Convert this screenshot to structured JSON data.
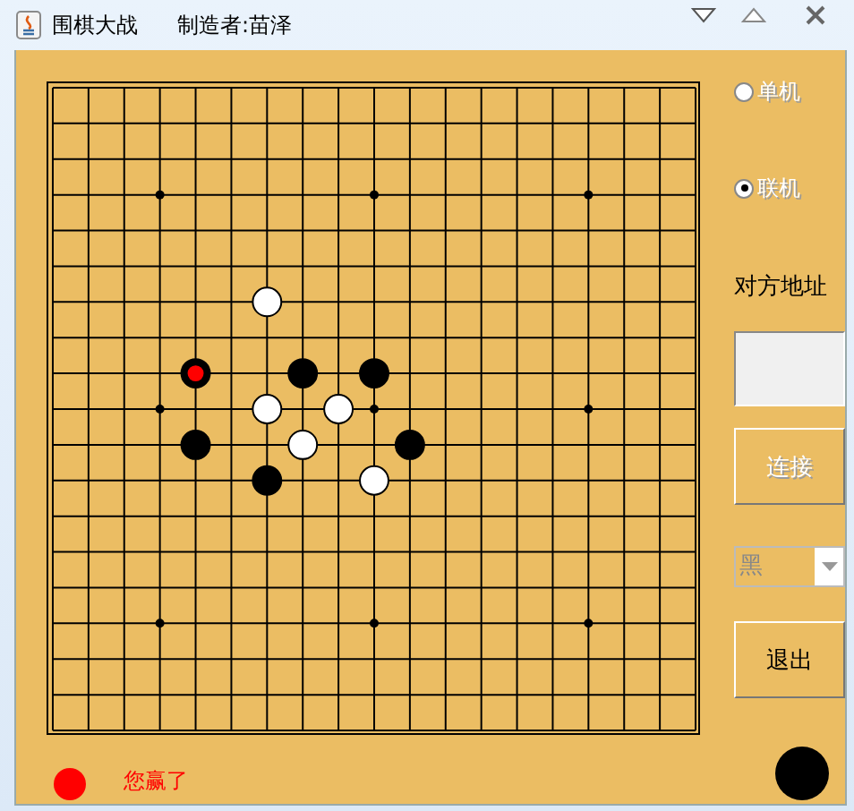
{
  "window": {
    "title": "围棋大战",
    "author": "制造者:苗泽"
  },
  "board": {
    "rows": [
      {
        "points": [
          {
            "kind": "empty"
          },
          {
            "kind": "empty"
          },
          {
            "kind": "empty"
          },
          {
            "kind": "empty"
          },
          {
            "kind": "empty"
          },
          {
            "kind": "empty"
          },
          {
            "kind": "empty"
          },
          {
            "kind": "empty"
          },
          {
            "kind": "empty"
          },
          {
            "kind": "empty"
          },
          {
            "kind": "empty"
          },
          {
            "kind": "empty"
          },
          {
            "kind": "empty"
          },
          {
            "kind": "empty"
          },
          {
            "kind": "empty"
          },
          {
            "kind": "empty"
          },
          {
            "kind": "empty"
          },
          {
            "kind": "empty"
          },
          {
            "kind": "empty"
          }
        ]
      },
      {
        "points": [
          {
            "kind": "empty"
          },
          {
            "kind": "empty"
          },
          {
            "kind": "empty"
          },
          {
            "kind": "empty"
          },
          {
            "kind": "empty"
          },
          {
            "kind": "empty"
          },
          {
            "kind": "empty"
          },
          {
            "kind": "empty"
          },
          {
            "kind": "empty"
          },
          {
            "kind": "empty"
          },
          {
            "kind": "empty"
          },
          {
            "kind": "empty"
          },
          {
            "kind": "empty"
          },
          {
            "kind": "empty"
          },
          {
            "kind": "empty"
          },
          {
            "kind": "empty"
          },
          {
            "kind": "empty"
          },
          {
            "kind": "empty"
          },
          {
            "kind": "empty"
          }
        ]
      },
      {
        "points": [
          {
            "kind": "empty"
          },
          {
            "kind": "empty"
          },
          {
            "kind": "empty"
          },
          {
            "kind": "empty"
          },
          {
            "kind": "empty"
          },
          {
            "kind": "empty"
          },
          {
            "kind": "empty"
          },
          {
            "kind": "empty"
          },
          {
            "kind": "empty"
          },
          {
            "kind": "empty"
          },
          {
            "kind": "empty"
          },
          {
            "kind": "empty"
          },
          {
            "kind": "empty"
          },
          {
            "kind": "empty"
          },
          {
            "kind": "empty"
          },
          {
            "kind": "empty"
          },
          {
            "kind": "empty"
          },
          {
            "kind": "empty"
          },
          {
            "kind": "empty"
          }
        ]
      },
      {
        "points": [
          {
            "kind": "empty"
          },
          {
            "kind": "empty"
          },
          {
            "kind": "empty"
          },
          {
            "kind": "empty"
          },
          {
            "kind": "empty"
          },
          {
            "kind": "empty"
          },
          {
            "kind": "empty"
          },
          {
            "kind": "empty"
          },
          {
            "kind": "empty"
          },
          {
            "kind": "empty"
          },
          {
            "kind": "empty"
          },
          {
            "kind": "empty"
          },
          {
            "kind": "empty"
          },
          {
            "kind": "empty"
          },
          {
            "kind": "empty"
          },
          {
            "kind": "empty"
          },
          {
            "kind": "empty"
          },
          {
            "kind": "empty"
          },
          {
            "kind": "empty"
          }
        ]
      },
      {
        "points": [
          {
            "kind": "empty"
          },
          {
            "kind": "empty"
          },
          {
            "kind": "empty"
          },
          {
            "kind": "empty"
          },
          {
            "kind": "empty"
          },
          {
            "kind": "empty"
          },
          {
            "kind": "empty"
          },
          {
            "kind": "empty"
          },
          {
            "kind": "empty"
          },
          {
            "kind": "empty"
          },
          {
            "kind": "empty"
          },
          {
            "kind": "empty"
          },
          {
            "kind": "empty"
          },
          {
            "kind": "empty"
          },
          {
            "kind": "empty"
          },
          {
            "kind": "empty"
          },
          {
            "kind": "empty"
          },
          {
            "kind": "empty"
          },
          {
            "kind": "empty"
          }
        ]
      },
      {
        "points": [
          {
            "kind": "empty"
          },
          {
            "kind": "empty"
          },
          {
            "kind": "empty"
          },
          {
            "kind": "empty"
          },
          {
            "kind": "empty"
          },
          {
            "kind": "empty"
          },
          {
            "kind": "empty"
          },
          {
            "kind": "empty"
          },
          {
            "kind": "empty"
          },
          {
            "kind": "empty"
          },
          {
            "kind": "empty"
          },
          {
            "kind": "empty"
          },
          {
            "kind": "empty"
          },
          {
            "kind": "empty"
          },
          {
            "kind": "empty"
          },
          {
            "kind": "empty"
          },
          {
            "kind": "empty"
          },
          {
            "kind": "empty"
          },
          {
            "kind": "empty"
          }
        ]
      },
      {
        "points": [
          {
            "kind": "empty"
          },
          {
            "kind": "empty"
          },
          {
            "kind": "empty"
          },
          {
            "kind": "empty"
          },
          {
            "kind": "empty"
          },
          {
            "kind": "empty"
          },
          {
            "kind": "white"
          },
          {
            "kind": "empty"
          },
          {
            "kind": "empty"
          },
          {
            "kind": "empty"
          },
          {
            "kind": "empty"
          },
          {
            "kind": "empty"
          },
          {
            "kind": "empty"
          },
          {
            "kind": "empty"
          },
          {
            "kind": "empty"
          },
          {
            "kind": "empty"
          },
          {
            "kind": "empty"
          },
          {
            "kind": "empty"
          },
          {
            "kind": "empty"
          }
        ]
      },
      {
        "points": [
          {
            "kind": "empty"
          },
          {
            "kind": "empty"
          },
          {
            "kind": "empty"
          },
          {
            "kind": "empty"
          },
          {
            "kind": "empty"
          },
          {
            "kind": "empty"
          },
          {
            "kind": "empty"
          },
          {
            "kind": "empty"
          },
          {
            "kind": "empty"
          },
          {
            "kind": "empty"
          },
          {
            "kind": "empty"
          },
          {
            "kind": "empty"
          },
          {
            "kind": "empty"
          },
          {
            "kind": "empty"
          },
          {
            "kind": "empty"
          },
          {
            "kind": "empty"
          },
          {
            "kind": "empty"
          },
          {
            "kind": "empty"
          },
          {
            "kind": "empty"
          }
        ]
      },
      {
        "points": [
          {
            "kind": "empty"
          },
          {
            "kind": "empty"
          },
          {
            "kind": "empty"
          },
          {
            "kind": "empty"
          },
          {
            "kind": "last"
          },
          {
            "kind": "empty"
          },
          {
            "kind": "empty"
          },
          {
            "kind": "black"
          },
          {
            "kind": "empty"
          },
          {
            "kind": "black"
          },
          {
            "kind": "empty"
          },
          {
            "kind": "empty"
          },
          {
            "kind": "empty"
          },
          {
            "kind": "empty"
          },
          {
            "kind": "empty"
          },
          {
            "kind": "empty"
          },
          {
            "kind": "empty"
          },
          {
            "kind": "empty"
          },
          {
            "kind": "empty"
          }
        ]
      },
      {
        "points": [
          {
            "kind": "empty"
          },
          {
            "kind": "empty"
          },
          {
            "kind": "empty"
          },
          {
            "kind": "empty"
          },
          {
            "kind": "empty"
          },
          {
            "kind": "empty"
          },
          {
            "kind": "white"
          },
          {
            "kind": "empty"
          },
          {
            "kind": "white"
          },
          {
            "kind": "empty"
          },
          {
            "kind": "empty"
          },
          {
            "kind": "empty"
          },
          {
            "kind": "empty"
          },
          {
            "kind": "empty"
          },
          {
            "kind": "empty"
          },
          {
            "kind": "empty"
          },
          {
            "kind": "empty"
          },
          {
            "kind": "empty"
          },
          {
            "kind": "empty"
          }
        ]
      },
      {
        "points": [
          {
            "kind": "empty"
          },
          {
            "kind": "empty"
          },
          {
            "kind": "empty"
          },
          {
            "kind": "empty"
          },
          {
            "kind": "black"
          },
          {
            "kind": "empty"
          },
          {
            "kind": "empty"
          },
          {
            "kind": "white"
          },
          {
            "kind": "empty"
          },
          {
            "kind": "empty"
          },
          {
            "kind": "black"
          },
          {
            "kind": "empty"
          },
          {
            "kind": "empty"
          },
          {
            "kind": "empty"
          },
          {
            "kind": "empty"
          },
          {
            "kind": "empty"
          },
          {
            "kind": "empty"
          },
          {
            "kind": "empty"
          },
          {
            "kind": "empty"
          }
        ]
      },
      {
        "points": [
          {
            "kind": "empty"
          },
          {
            "kind": "empty"
          },
          {
            "kind": "empty"
          },
          {
            "kind": "empty"
          },
          {
            "kind": "empty"
          },
          {
            "kind": "empty"
          },
          {
            "kind": "black"
          },
          {
            "kind": "empty"
          },
          {
            "kind": "empty"
          },
          {
            "kind": "white"
          },
          {
            "kind": "empty"
          },
          {
            "kind": "empty"
          },
          {
            "kind": "empty"
          },
          {
            "kind": "empty"
          },
          {
            "kind": "empty"
          },
          {
            "kind": "empty"
          },
          {
            "kind": "empty"
          },
          {
            "kind": "empty"
          },
          {
            "kind": "empty"
          }
        ]
      },
      {
        "points": [
          {
            "kind": "empty"
          },
          {
            "kind": "empty"
          },
          {
            "kind": "empty"
          },
          {
            "kind": "empty"
          },
          {
            "kind": "empty"
          },
          {
            "kind": "empty"
          },
          {
            "kind": "empty"
          },
          {
            "kind": "empty"
          },
          {
            "kind": "empty"
          },
          {
            "kind": "empty"
          },
          {
            "kind": "empty"
          },
          {
            "kind": "empty"
          },
          {
            "kind": "empty"
          },
          {
            "kind": "empty"
          },
          {
            "kind": "empty"
          },
          {
            "kind": "empty"
          },
          {
            "kind": "empty"
          },
          {
            "kind": "empty"
          },
          {
            "kind": "empty"
          }
        ]
      },
      {
        "points": [
          {
            "kind": "empty"
          },
          {
            "kind": "empty"
          },
          {
            "kind": "empty"
          },
          {
            "kind": "empty"
          },
          {
            "kind": "empty"
          },
          {
            "kind": "empty"
          },
          {
            "kind": "empty"
          },
          {
            "kind": "empty"
          },
          {
            "kind": "empty"
          },
          {
            "kind": "empty"
          },
          {
            "kind": "empty"
          },
          {
            "kind": "empty"
          },
          {
            "kind": "empty"
          },
          {
            "kind": "empty"
          },
          {
            "kind": "empty"
          },
          {
            "kind": "empty"
          },
          {
            "kind": "empty"
          },
          {
            "kind": "empty"
          },
          {
            "kind": "empty"
          }
        ]
      },
      {
        "points": [
          {
            "kind": "empty"
          },
          {
            "kind": "empty"
          },
          {
            "kind": "empty"
          },
          {
            "kind": "empty"
          },
          {
            "kind": "empty"
          },
          {
            "kind": "empty"
          },
          {
            "kind": "empty"
          },
          {
            "kind": "empty"
          },
          {
            "kind": "empty"
          },
          {
            "kind": "empty"
          },
          {
            "kind": "empty"
          },
          {
            "kind": "empty"
          },
          {
            "kind": "empty"
          },
          {
            "kind": "empty"
          },
          {
            "kind": "empty"
          },
          {
            "kind": "empty"
          },
          {
            "kind": "empty"
          },
          {
            "kind": "empty"
          },
          {
            "kind": "empty"
          }
        ]
      },
      {
        "points": [
          {
            "kind": "empty"
          },
          {
            "kind": "empty"
          },
          {
            "kind": "empty"
          },
          {
            "kind": "empty"
          },
          {
            "kind": "empty"
          },
          {
            "kind": "empty"
          },
          {
            "kind": "empty"
          },
          {
            "kind": "empty"
          },
          {
            "kind": "empty"
          },
          {
            "kind": "empty"
          },
          {
            "kind": "empty"
          },
          {
            "kind": "empty"
          },
          {
            "kind": "empty"
          },
          {
            "kind": "empty"
          },
          {
            "kind": "empty"
          },
          {
            "kind": "empty"
          },
          {
            "kind": "empty"
          },
          {
            "kind": "empty"
          },
          {
            "kind": "empty"
          }
        ]
      },
      {
        "points": [
          {
            "kind": "empty"
          },
          {
            "kind": "empty"
          },
          {
            "kind": "empty"
          },
          {
            "kind": "empty"
          },
          {
            "kind": "empty"
          },
          {
            "kind": "empty"
          },
          {
            "kind": "empty"
          },
          {
            "kind": "empty"
          },
          {
            "kind": "empty"
          },
          {
            "kind": "empty"
          },
          {
            "kind": "empty"
          },
          {
            "kind": "empty"
          },
          {
            "kind": "empty"
          },
          {
            "kind": "empty"
          },
          {
            "kind": "empty"
          },
          {
            "kind": "empty"
          },
          {
            "kind": "empty"
          },
          {
            "kind": "empty"
          },
          {
            "kind": "empty"
          }
        ]
      },
      {
        "points": [
          {
            "kind": "empty"
          },
          {
            "kind": "empty"
          },
          {
            "kind": "empty"
          },
          {
            "kind": "empty"
          },
          {
            "kind": "empty"
          },
          {
            "kind": "empty"
          },
          {
            "kind": "empty"
          },
          {
            "kind": "empty"
          },
          {
            "kind": "empty"
          },
          {
            "kind": "empty"
          },
          {
            "kind": "empty"
          },
          {
            "kind": "empty"
          },
          {
            "kind": "empty"
          },
          {
            "kind": "empty"
          },
          {
            "kind": "empty"
          },
          {
            "kind": "empty"
          },
          {
            "kind": "empty"
          },
          {
            "kind": "empty"
          },
          {
            "kind": "empty"
          }
        ]
      },
      {
        "points": [
          {
            "kind": "empty"
          },
          {
            "kind": "empty"
          },
          {
            "kind": "empty"
          },
          {
            "kind": "empty"
          },
          {
            "kind": "empty"
          },
          {
            "kind": "empty"
          },
          {
            "kind": "empty"
          },
          {
            "kind": "empty"
          },
          {
            "kind": "empty"
          },
          {
            "kind": "empty"
          },
          {
            "kind": "empty"
          },
          {
            "kind": "empty"
          },
          {
            "kind": "empty"
          },
          {
            "kind": "empty"
          },
          {
            "kind": "empty"
          },
          {
            "kind": "empty"
          },
          {
            "kind": "empty"
          },
          {
            "kind": "empty"
          },
          {
            "kind": "empty"
          }
        ]
      }
    ]
  },
  "mode_options": [
    {
      "label": "单机",
      "selected": false,
      "disabled": true
    },
    {
      "label": "联机",
      "selected": true,
      "disabled": true
    }
  ],
  "address_label": "对方地址",
  "connect_button": {
    "label": "连接",
    "disabled": true
  },
  "color_select": {
    "value": "黑",
    "disabled": true
  },
  "exit_button": {
    "label": "退出",
    "disabled": false
  },
  "status": {
    "message": "您赢了",
    "stones": [
      {
        "color": "#ff0000"
      },
      {
        "color": "#000000"
      }
    ]
  }
}
